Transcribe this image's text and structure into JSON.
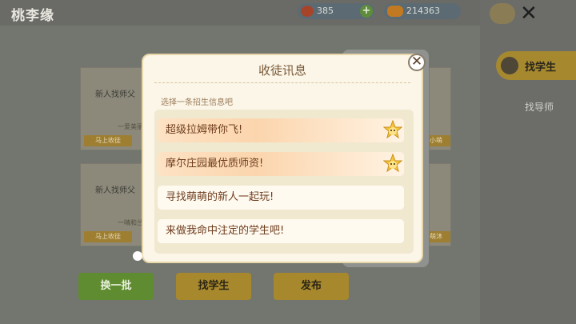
{
  "app": {
    "title": "桃李缘",
    "gems": "385",
    "coins": "214363",
    "gems_plus": "+",
    "close_glyph": "✕"
  },
  "right_tabs": [
    {
      "label": "找学生",
      "active": true
    },
    {
      "label": "找导师",
      "active": false
    }
  ],
  "background_cards": [
    {
      "title": "新人找师父",
      "note": "一爱美丽",
      "button": "马上收徒"
    },
    {
      "title": "新人找师父",
      "note": "一晴和兰",
      "button": "马上收徒"
    }
  ],
  "background_cards_right": [
    {
      "button": "小萌"
    },
    {
      "button": "萌沐"
    }
  ],
  "bottom_buttons": [
    {
      "label": "换一批",
      "color": "#5f8c30"
    },
    {
      "label": "找学生",
      "color": "#a7882c"
    },
    {
      "label": "发布",
      "color": "#a7882c"
    }
  ],
  "modal": {
    "title": "收徒讯息",
    "subtitle": "选择一条招生信息吧",
    "close_glyph": "✕",
    "options": [
      {
        "text": "超级拉姆带你飞!",
        "highlighted": true,
        "icon": "star-mascot-icon"
      },
      {
        "text": "摩尔庄园最优质师资!",
        "highlighted": true,
        "icon": "star-mascot-icon"
      },
      {
        "text": "寻找萌萌的新人一起玩!",
        "highlighted": false
      },
      {
        "text": "来做我命中注定的学生吧!",
        "highlighted": false
      }
    ]
  },
  "colors": {
    "modal_bg": "#fbf6e8",
    "text_brown": "#6e3c1d",
    "accent_gold": "#a7882c",
    "accent_green": "#5f8c30"
  }
}
